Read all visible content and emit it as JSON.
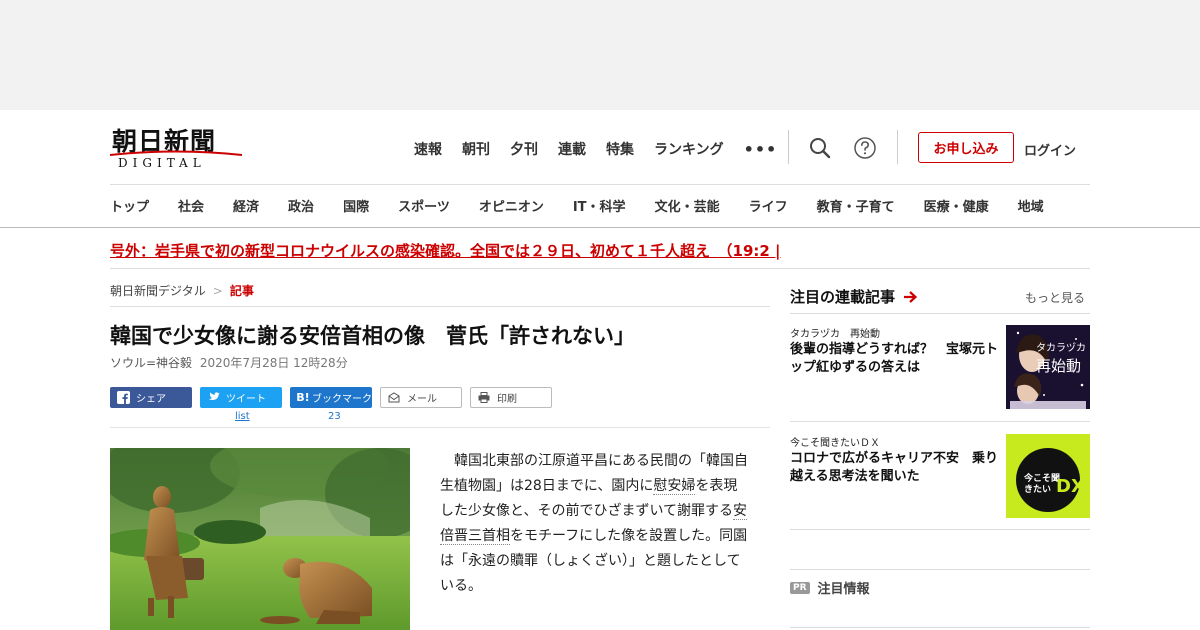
{
  "header": {
    "logo_text": "朝日新聞",
    "logo_sub": "DIGITAL",
    "topnav": [
      "速報",
      "朝刊",
      "夕刊",
      "連載",
      "特集",
      "ランキング"
    ],
    "more_label": "•••",
    "apply_label": "お申し込み",
    "login_label": "ログイン"
  },
  "categories": [
    "トップ",
    "社会",
    "経済",
    "政治",
    "国際",
    "スポーツ",
    "オピニオン",
    "IT・科学",
    "文化・芸能",
    "ライフ",
    "教育・子育て",
    "医療・健康",
    "地域"
  ],
  "breaking": "号外：岩手県で初の新型コロナウイルスの感染確認。全国では２９日、初めて１千人超え　（19:2 |",
  "breadcrumb": {
    "home": "朝日新聞デジタル",
    "separator": ">",
    "current": "記事"
  },
  "article": {
    "headline": "韓国で少女像に謝る安倍首相の像　菅氏「許されない」",
    "author": "ソウル=神谷毅",
    "date": "2020年7月28日 12時28分",
    "share": {
      "facebook": "シェア",
      "twitter": "ツイート",
      "twitter_count": "list",
      "hatena": "ブックマーク",
      "hatena_count": "23",
      "mail": "メール",
      "print": "印刷"
    },
    "body": {
      "p1": "韓国北東部の江原道平昌にある民間の「韓国自生植物園」は28日までに、園内に",
      "link1": "慰安婦",
      "p2": "を表現した少女像と、その前でひざまずいて謝罪する",
      "link2": "安倍晋三首相",
      "p3": "をモチーフにした像を設置した。同園は「永遠の贖罪（しょくざい）」と題したとしている。"
    }
  },
  "aside": {
    "title": "注目の連載記事",
    "more": "もっと見る",
    "cards": [
      {
        "kicker": "タカラヅカ　再始動",
        "title": "後輩の指導どうすれば？　宝塚元トップ紅ゆずるの答えは",
        "thumb_caption": "タカラヅカ",
        "thumb_title": "再始動"
      },
      {
        "kicker": "今こそ聞きたいＤＸ",
        "title": "コロナで広がるキャリア不安　乗り越える思考法を聞いた",
        "thumb_caption": "今こそ聞きたい",
        "thumb_title": "DX"
      }
    ],
    "pr_badge": "PR",
    "pr_label": "注目情報"
  },
  "colors": {
    "accent_red": "#cc0000",
    "facebook": "#3b5998",
    "twitter": "#1da1f2",
    "hatena": "#1d75cc",
    "dx_green": "#c6ea1e"
  }
}
